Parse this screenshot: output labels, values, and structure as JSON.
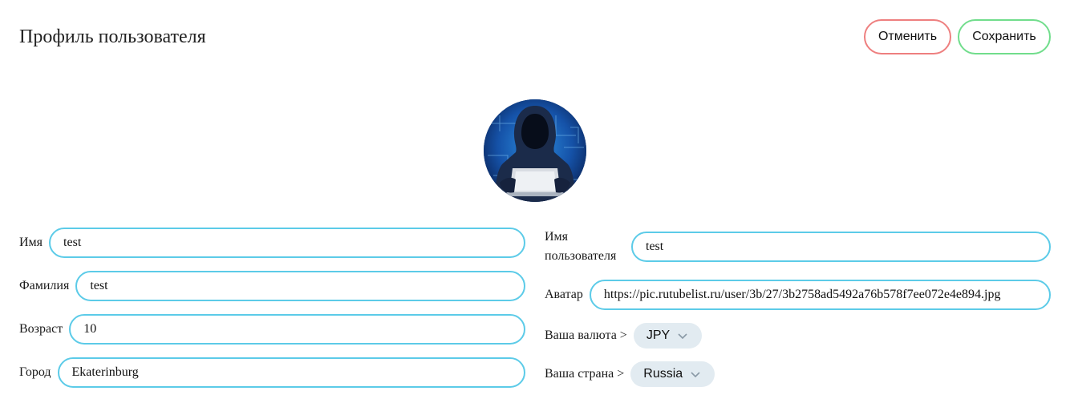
{
  "header": {
    "title": "Профиль пользователя",
    "cancel_label": "Отменить",
    "save_label": "Сохранить"
  },
  "colors": {
    "cancel_border": "#ee7f7f",
    "save_border": "#71dd8c",
    "input_border": "#5ccbe8",
    "select_bg": "#e2ebf1"
  },
  "avatar": {
    "icon": "hooded-hacker-avatar"
  },
  "form": {
    "first_name": {
      "label": "Имя",
      "value": "test"
    },
    "last_name": {
      "label": "Фамилия",
      "value": "test"
    },
    "age": {
      "label": "Возраст",
      "value": "10"
    },
    "city": {
      "label": "Город",
      "value": "Ekaterinburg"
    },
    "username": {
      "label": "Имя пользователя",
      "value": "test"
    },
    "avatar_url": {
      "label": "Аватар",
      "value": "https://pic.rutubelist.ru/user/3b/27/3b2758ad5492a76b578f7ee072e4e894.jpg"
    },
    "currency": {
      "label": "Ваша валюта >",
      "value": "JPY"
    },
    "country": {
      "label": "Ваша страна >",
      "value": "Russia"
    }
  }
}
